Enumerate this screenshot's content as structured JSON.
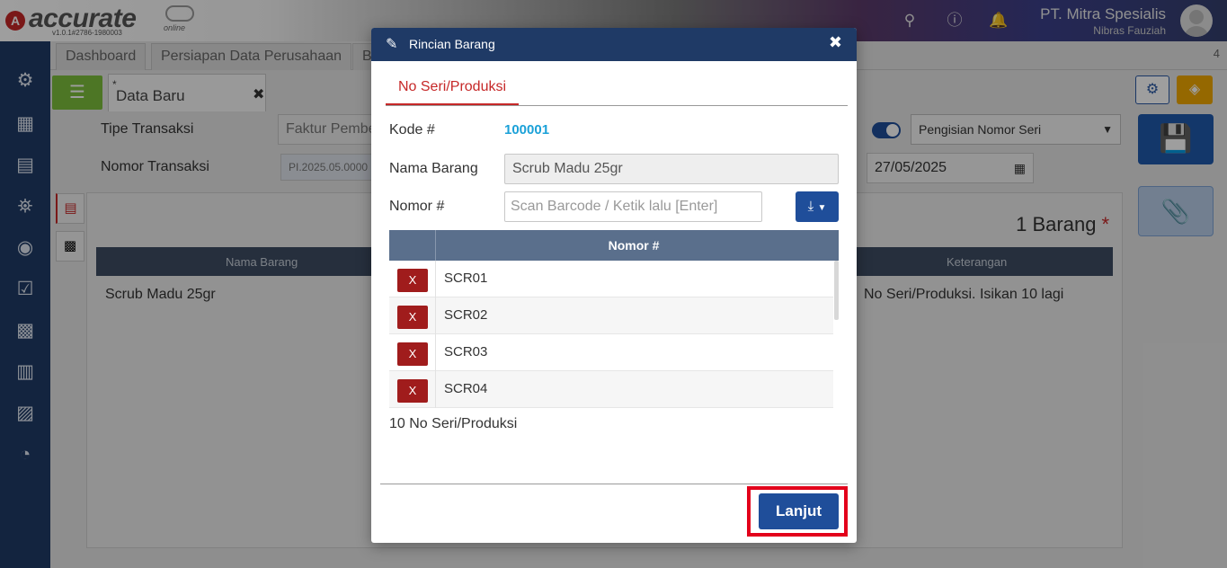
{
  "header": {
    "brand": "accurate",
    "brand_sub": "online",
    "version": "v1.0.1#2786-1980003",
    "company_name": "PT. Mitra Spesialis",
    "user_name": "Nibras Fauziah"
  },
  "tabs": [
    {
      "label": "Dashboard"
    },
    {
      "label": "Persiapan Data Perusahaan"
    },
    {
      "label": "B"
    }
  ],
  "tab_count": "4",
  "active_tab": {
    "star": "*",
    "label": "Data Baru"
  },
  "form": {
    "tipe_transaksi_label": "Tipe Transaksi",
    "tipe_transaksi_value": "Faktur Pembe",
    "nomor_transaksi_label": "Nomor Transaksi",
    "nomor_transaksi_value": "PI.2025.05.0000",
    "nomor_seri_select": "Pengisian Nomor Seri",
    "date": "27/05/2025",
    "item_count": "1 Barang",
    "required_mark": "*",
    "table_headers": {
      "nama_barang": "Nama Barang",
      "keterangan": "Keterangan"
    },
    "row_nama": "Scrub Madu 25gr",
    "row_keterangan": "No Seri/Produksi. Isikan 10 lagi"
  },
  "modal": {
    "title": "Rincian Barang",
    "tab_label": "No Seri/Produksi",
    "kode_label": "Kode #",
    "kode_value": "100001",
    "nama_barang_label": "Nama Barang",
    "nama_barang_value": "Scrub Madu 25gr",
    "nomor_label": "Nomor #",
    "nomor_placeholder": "Scan Barcode / Ketik lalu [Enter]",
    "grid_header": "Nomor #",
    "delete_label": "X",
    "serials": [
      "SCR01",
      "SCR02",
      "SCR03",
      "SCR04"
    ],
    "serial_count": "10 No Seri/Produksi",
    "continue_label": "Lanjut"
  },
  "colors": {
    "brand_red": "#c62828",
    "primary_blue": "#1f4e9a",
    "sidebar_navy": "#1f3a66",
    "highlight_red": "#e3001b",
    "code_blue": "#1ba1d8"
  }
}
